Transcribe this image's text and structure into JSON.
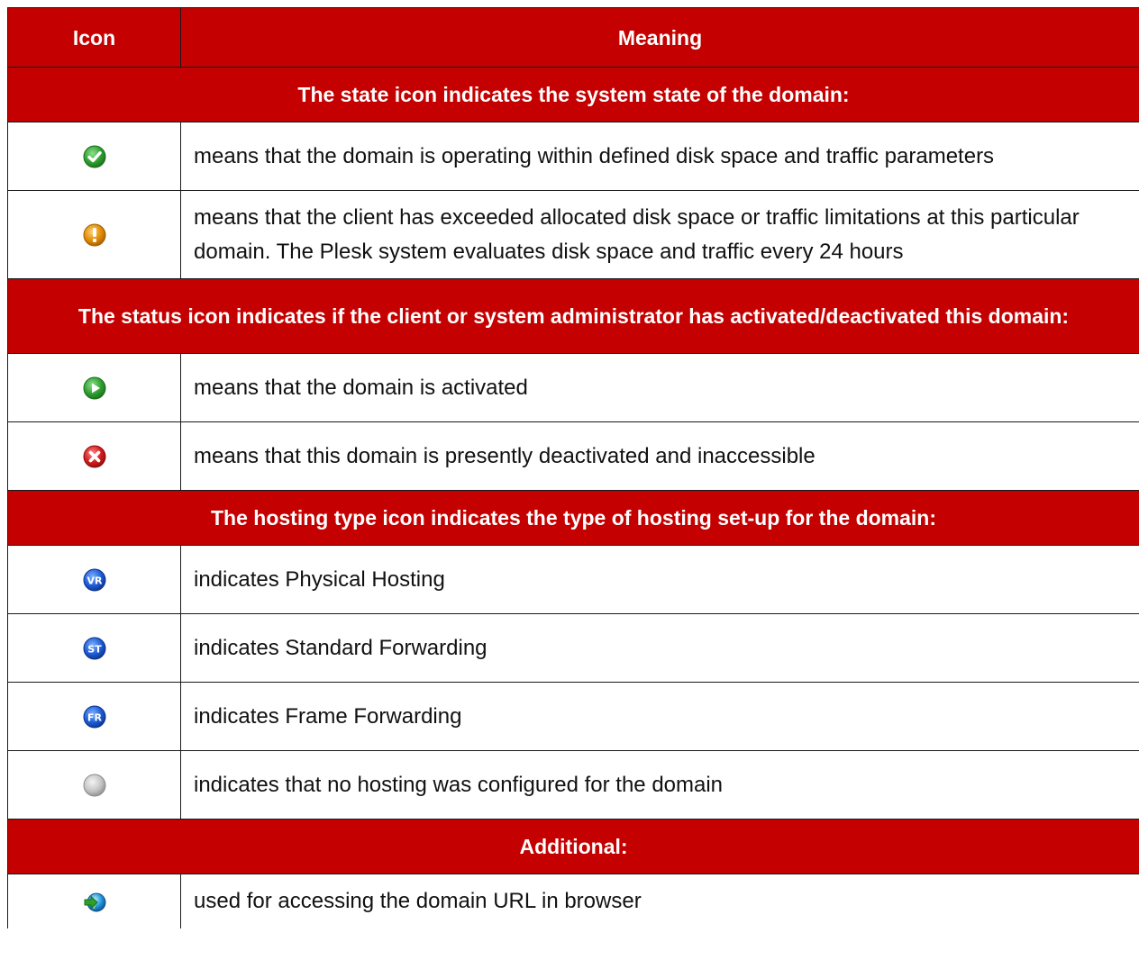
{
  "header": {
    "icon": "Icon",
    "meaning": "Meaning"
  },
  "sections": [
    {
      "title": "The state icon indicates the system state of the domain:",
      "rows": [
        {
          "icon": "green-checkmark-icon",
          "text": "means that the domain is operating within defined disk space and traffic parameters"
        },
        {
          "icon": "orange-exclamation-icon",
          "text": "means that the client has exceeded allocated disk space or traffic limitations at this particular domain. The Plesk system evaluates disk space and traffic every 24 hours"
        }
      ]
    },
    {
      "title": "The status icon indicates if the client or system administrator has activated/deactivated this domain:",
      "rows": [
        {
          "icon": "green-play-icon",
          "text": "means that the domain is activated"
        },
        {
          "icon": "red-x-icon",
          "text": "means that this domain is presently deactivated and inaccessible"
        }
      ]
    },
    {
      "title": "The hosting type icon indicates the type of hosting set-up for the domain:",
      "rows": [
        {
          "icon": "blue-vr-icon",
          "icon_text": "VR",
          "text": "indicates Physical Hosting"
        },
        {
          "icon": "blue-st-icon",
          "icon_text": "ST",
          "text": "indicates Standard Forwarding"
        },
        {
          "icon": "blue-fr-icon",
          "icon_text": "FR",
          "text": "indicates Frame Forwarding"
        },
        {
          "icon": "gray-circle-icon",
          "text": "indicates that no hosting was configured for the domain"
        }
      ]
    },
    {
      "title": "Additional:",
      "rows": [
        {
          "icon": "green-arrow-globe-icon",
          "text": "used for accessing the domain URL in browser"
        }
      ]
    }
  ],
  "colors": {
    "header_bg": "#c40000",
    "header_text": "#ffffff",
    "border": "#1a1a1a",
    "check_green": "#2e9e2e",
    "warn_orange": "#e08a00",
    "error_red": "#d21b1b",
    "hosting_blue": "#1d5bd6",
    "none_gray": "#b8b8b8"
  }
}
